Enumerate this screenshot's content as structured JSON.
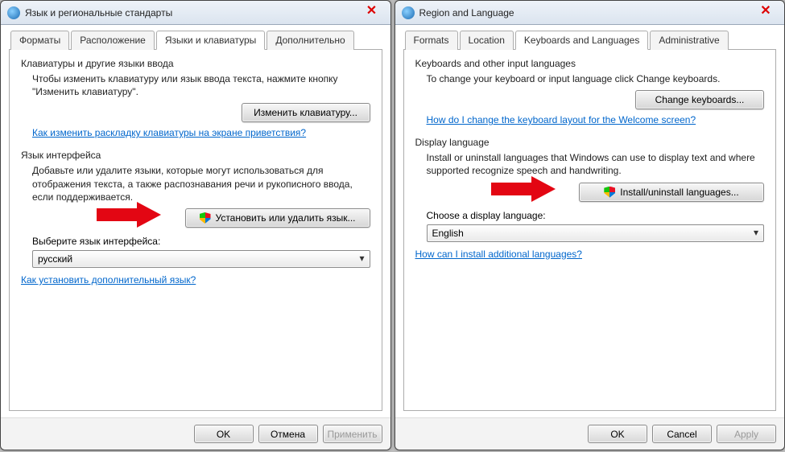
{
  "left": {
    "title": "Язык и региональные стандарты",
    "tabs": [
      "Форматы",
      "Расположение",
      "Языки и клавиатуры",
      "Дополнительно"
    ],
    "active_tab": 2,
    "section1": {
      "title": "Клавиатуры и другие языки ввода",
      "desc": "Чтобы изменить клавиатуру или язык ввода текста, нажмите кнопку \"Изменить клавиатуру\".",
      "button": "Изменить клавиатуру...",
      "link": "Как изменить раскладку клавиатуры на экране приветствия?"
    },
    "section2": {
      "title": "Язык интерфейса",
      "desc": "Добавьте или удалите языки, которые могут использоваться для отображения текста, а также распознавания речи и рукописного ввода, если           поддерживается.",
      "button": "Установить или удалить язык...",
      "label": "Выберите язык интерфейса:",
      "combo": "русский"
    },
    "bottom_link": "Как установить дополнительный язык?",
    "ok": "OK",
    "cancel": "Отмена",
    "apply": "Применить"
  },
  "right": {
    "title": "Region and Language",
    "tabs": [
      "Formats",
      "Location",
      "Keyboards and Languages",
      "Administrative"
    ],
    "active_tab": 2,
    "section1": {
      "title": "Keyboards and other input languages",
      "desc": "To change your keyboard or input language click Change keyboards.",
      "button": "Change keyboards...",
      "link": "How do I change the keyboard layout for the Welcome screen?"
    },
    "section2": {
      "title": "Display language",
      "desc": "Install or uninstall languages that Windows can use to display text and where supported recognize speech and handwriting.",
      "button": "Install/uninstall languages...",
      "label": "Choose a display language:",
      "combo": "English"
    },
    "bottom_link": "How can I install additional languages?",
    "ok": "OK",
    "cancel": "Cancel",
    "apply": "Apply"
  }
}
